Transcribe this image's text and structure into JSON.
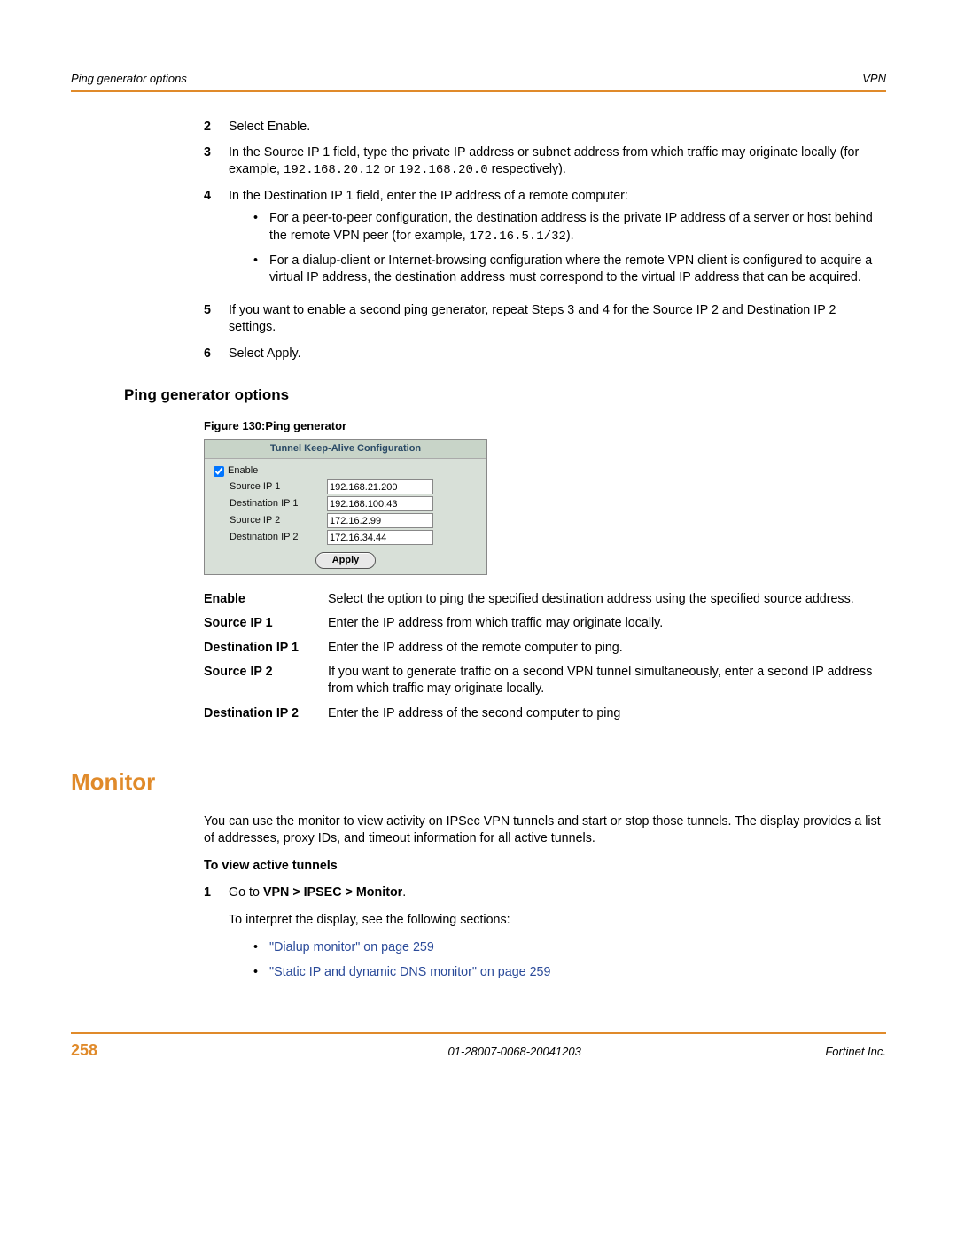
{
  "header": {
    "left": "Ping generator options",
    "right": "VPN"
  },
  "steps": [
    {
      "n": "2",
      "text": "Select Enable.",
      "bullets": []
    },
    {
      "n": "3",
      "text": "In the Source IP 1 field, type the private IP address or subnet address from which traffic may originate locally (for example, 192.168.20.12 or 192.168.20.0 respectively).",
      "bullets": []
    },
    {
      "n": "4",
      "text": "In the Destination IP 1 field, enter the IP address of a remote computer:",
      "bullets": [
        "For a peer-to-peer configuration, the destination address is the private IP address of a server or host behind the remote VPN peer (for example, 172.16.5.1/32).",
        "For a dialup-client or Internet-browsing configuration where the remote VPN client is configured to acquire a virtual IP address, the destination address must correspond to the virtual IP address that can be acquired."
      ]
    },
    {
      "n": "5",
      "text": "If you want to enable a second ping generator, repeat Steps 3 and 4 for the Source IP 2 and Destination IP 2 settings.",
      "bullets": []
    },
    {
      "n": "6",
      "text": "Select Apply.",
      "bullets": []
    }
  ],
  "section_heading": "Ping generator options",
  "fig_caption": "Figure 130:Ping generator",
  "dialog": {
    "title": "Tunnel Keep-Alive Configuration",
    "enable_label": "Enable",
    "enable_checked": true,
    "rows": [
      {
        "label": "Source IP 1",
        "value": "192.168.21.200"
      },
      {
        "label": "Destination IP 1",
        "value": "192.168.100.43"
      },
      {
        "label": "Source IP 2",
        "value": "172.16.2.99"
      },
      {
        "label": "Destination IP 2",
        "value": "172.16.34.44"
      }
    ],
    "apply_label": "Apply"
  },
  "defs": [
    {
      "term": "Enable",
      "desc": "Select the option to ping the specified destination address using the specified source address."
    },
    {
      "term": "Source IP 1",
      "desc": "Enter the IP address from which traffic may originate locally."
    },
    {
      "term": "Destination IP 1",
      "desc": "Enter the IP address of the remote computer to ping."
    },
    {
      "term": "Source IP 2",
      "desc": "If you want to generate traffic on a second VPN tunnel simultaneously, enter a second IP address from which traffic may originate locally."
    },
    {
      "term": "Destination IP 2",
      "desc": "Enter the IP address of the second computer to ping"
    }
  ],
  "monitor": {
    "heading": "Monitor",
    "intro": "You can use the monitor to view activity on IPSec VPN tunnels and start or stop those tunnels. The display provides a list of addresses, proxy IDs, and timeout information for all active tunnels.",
    "howto_heading": "To view active tunnels",
    "step1_num": "1",
    "step1_pre": "Go to ",
    "step1_bold": "VPN > IPSEC > Monitor",
    "step1_post": ".",
    "interp": "To interpret the display, see the following sections:",
    "links": [
      "\"Dialup monitor\" on page 259",
      "\"Static IP and dynamic DNS monitor\" on page 259"
    ]
  },
  "footer": {
    "page": "258",
    "docid": "01-28007-0068-20041203",
    "company": "Fortinet Inc."
  }
}
